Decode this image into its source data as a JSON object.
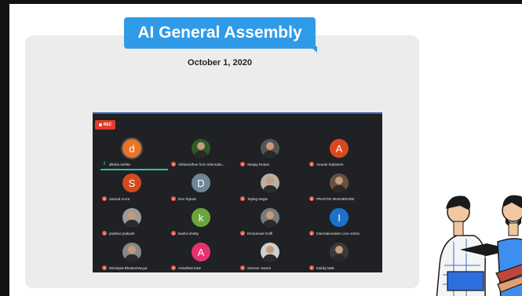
{
  "slide": {
    "title": "AI General Assembly",
    "date": "October 1, 2020"
  },
  "meeting": {
    "rec_label": "REC",
    "participants": [
      {
        "name": "diksha mehta",
        "avatar": "letter",
        "initial": "d",
        "color": "#e8742a",
        "speaking": true
      },
      {
        "name": "Abhivardhan from Internatio...",
        "avatar": "photo",
        "initial": "",
        "color": "#2e5a2a",
        "speaking": false
      },
      {
        "name": "Sanjay Notani",
        "avatar": "photo",
        "initial": "",
        "color": "#555555",
        "speaking": false
      },
      {
        "name": "Anurati Sukanem",
        "avatar": "letter",
        "initial": "A",
        "color": "#d9481f",
        "speaking": false
      },
      {
        "name": "Samad Arora",
        "avatar": "letter",
        "initial": "S",
        "color": "#d34b1d",
        "speaking": false
      },
      {
        "name": "Dev Tejnani",
        "avatar": "letter",
        "initial": "D",
        "color": "#6e8796",
        "speaking": false
      },
      {
        "name": "Tayleg Negie",
        "avatar": "photo",
        "initial": "",
        "color": "#b8b0a8",
        "speaking": false
      },
      {
        "name": "PRANTIK MUKHERJEE",
        "avatar": "photo",
        "initial": "",
        "color": "#6a5040",
        "speaking": false
      },
      {
        "name": "prakhar prakash",
        "avatar": "photo",
        "initial": "",
        "color": "#9a9a9a",
        "speaking": false
      },
      {
        "name": "kashvi shetty",
        "avatar": "letter",
        "initial": "k",
        "color": "#6aa53c",
        "speaking": false
      },
      {
        "name": "Emmanuel Goffi",
        "avatar": "photo",
        "initial": "",
        "color": "#7a7a7a",
        "speaking": false
      },
      {
        "name": "Internationalism Live Admin",
        "avatar": "letter",
        "initial": "I",
        "color": "#1a73c9",
        "speaking": false
      },
      {
        "name": "Mridutpal Bhattacharyya",
        "avatar": "photo",
        "initial": "",
        "color": "#888888",
        "speaking": false
      },
      {
        "name": "Anindhati Kale",
        "avatar": "letter",
        "initial": "A",
        "color": "#e6336e",
        "speaking": false
      },
      {
        "name": "Sameer Samal",
        "avatar": "photo",
        "initial": "",
        "color": "#cfcfcf",
        "speaking": false
      },
      {
        "name": "Kalobj Naik",
        "avatar": "photo",
        "initial": "",
        "color": "#3a3a3a",
        "speaking": false
      }
    ]
  },
  "colors": {
    "title_bg": "#2f9ae8",
    "rec_bg": "#e13c2c",
    "speaking": "#23c4b0"
  }
}
